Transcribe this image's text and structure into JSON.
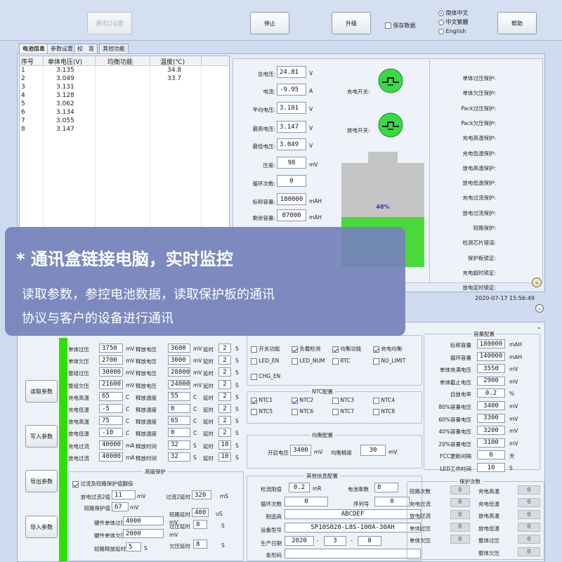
{
  "toolbar": {
    "comm_settings": "通讯口设置",
    "stop": "停止",
    "upgrade": "升级",
    "save_data": "保存数据",
    "help": "帮助",
    "languages": [
      "简体中文",
      "中文繁體",
      "English"
    ],
    "selected_language": "简体中文"
  },
  "tabs": [
    "电池信息",
    "参数设置",
    "校　准",
    "其他功能"
  ],
  "cell_table": {
    "headers": [
      "序号",
      "单体电压(V)",
      "均衡功能",
      "温度(℃)"
    ],
    "rows": [
      [
        "1",
        "3.135",
        "",
        "34.8"
      ],
      [
        "2",
        "3.049",
        "",
        "33.7"
      ],
      [
        "3",
        "3.131",
        "",
        ""
      ],
      [
        "4",
        "3.128",
        "",
        ""
      ],
      [
        "5",
        "3.062",
        "",
        ""
      ],
      [
        "6",
        "3.134",
        "",
        ""
      ],
      [
        "7",
        "3.055",
        "",
        ""
      ],
      [
        "8",
        "3.147",
        "",
        ""
      ]
    ]
  },
  "battery": {
    "total_voltage_label": "总电压:",
    "total_voltage": "24.81",
    "total_voltage_unit": "V",
    "current_label": "电流:",
    "current": "-9.95",
    "current_unit": "A",
    "avg_voltage_label": "平均电压:",
    "avg_voltage": "3.101",
    "avg_voltage_unit": "V",
    "max_voltage_label": "最高电压:",
    "max_voltage": "3.147",
    "max_voltage_unit": "V",
    "min_voltage_label": "最低电压:",
    "min_voltage": "3.049",
    "min_voltage_unit": "V",
    "diff_label": "压差:",
    "diff": "98",
    "diff_unit": "mV",
    "cycles_label": "循环次数:",
    "cycles": "0",
    "nominal_label": "标称容量:",
    "nominal": "180000",
    "nominal_unit": "mAH",
    "remaining_label": "剩余容量:",
    "remaining": "87000",
    "remaining_unit": "mAH",
    "charge_switch": "充电开关:",
    "discharge_switch": "放电开关:",
    "soc_text": "48%",
    "soc": 0.48,
    "soc_color": "#4bd83a"
  },
  "protections": [
    "单体过压保护:",
    "单体欠压保护:",
    "Pack过压保护:",
    "Pack欠压保护:",
    "充电高温保护:",
    "充电低温保护:",
    "放电高温保护:",
    "放电低温保护:",
    "充电过流保护:",
    "放电过流保护:",
    "短路保护:",
    "检测芯片错误:",
    "保护板锁定:",
    "充电超时锁定:",
    "放电定时锁定:"
  ],
  "timestamp": "2020-07-17 15:56:49",
  "overlay": {
    "title": "* 通讯盒链接电脑，实时监控",
    "line1": "读取参数，参控电池数据，读取保护板的通讯",
    "line2": "协议与客户的设备进行通讯"
  },
  "side_buttons": [
    "读取参数",
    "写入参数",
    "导出参数",
    "导入参数"
  ],
  "params": [
    {
      "l1": "单体过压",
      "v1": "3750",
      "u1": "mV",
      "l2": "释放电压",
      "v2": "3600",
      "u2": "mV",
      "l3": "延时",
      "v3": "2",
      "u3": "S"
    },
    {
      "l1": "单体欠压",
      "v1": "2700",
      "u1": "mV",
      "l2": "释放电压",
      "v2": "3000",
      "u2": "mV",
      "l3": "延时",
      "v3": "2",
      "u3": "S"
    },
    {
      "l1": "整组过压",
      "v1": "30000",
      "u1": "mV",
      "l2": "释放电压",
      "v2": "28800",
      "u2": "mV",
      "l3": "延时",
      "v3": "2",
      "u3": "S"
    },
    {
      "l1": "整组欠压",
      "v1": "21600",
      "u1": "mV",
      "l2": "释放电压",
      "v2": "24000",
      "u2": "mV",
      "l3": "延时",
      "v3": "2",
      "u3": "S"
    },
    {
      "l1": "充电高温",
      "v1": "65",
      "u1": "C",
      "l2": "释放温度",
      "v2": "55",
      "u2": "C",
      "l3": "延时",
      "v3": "2",
      "u3": "S"
    },
    {
      "l1": "充电低温",
      "v1": "-5",
      "u1": "C",
      "l2": "释放温度",
      "v2": "0",
      "u2": "C",
      "l3": "延时",
      "v3": "2",
      "u3": "S"
    },
    {
      "l1": "放电高温",
      "v1": "75",
      "u1": "C",
      "l2": "释放温度",
      "v2": "65",
      "u2": "C",
      "l3": "延时",
      "v3": "2",
      "u3": "S"
    },
    {
      "l1": "放电低温",
      "v1": "-10",
      "u1": "C",
      "l2": "释放温度",
      "v2": "0",
      "u2": "C",
      "l3": "延时",
      "v3": "2",
      "u3": "S"
    },
    {
      "l1": "充电过流",
      "v1": "40000",
      "u1": "mA",
      "l2": "释放时间",
      "v2": "32",
      "u2": "S",
      "l3": "延时",
      "v3": "10",
      "u3": "S"
    },
    {
      "l1": "放电过流",
      "v1": "40000",
      "u1": "mA",
      "l2": "释放时间",
      "v2": "32",
      "u2": "S",
      "l3": "延时",
      "v3": "10",
      "u3": "S"
    }
  ],
  "advanced": {
    "title": "高级保护",
    "checkbox": "过流及短路保护值翻倍",
    "oc2_label": "放电过流2值",
    "oc2": "11",
    "oc2_unit": "mV",
    "sc_label": "短路保护值",
    "sc": "67",
    "sc_unit": "mV",
    "oc2_delay_label": "过流2延时",
    "oc2_delay": "320",
    "oc2_delay_unit": "mS",
    "sc_delay_label": "短路延时",
    "sc_delay": "400",
    "sc_delay_unit": "uS",
    "hw_ov_label": "硬件单体过压",
    "hw_ov": "4000",
    "hw_ov_unit": "mV",
    "hw_uv_label": "硬件单体欠压",
    "hw_uv": "2000",
    "hw_uv_unit": "mV",
    "ov_delay_label": "过压延时",
    "ov_delay": "8",
    "ov_delay_unit": "S",
    "uv_delay_label": "欠压延时",
    "uv_delay": "8",
    "uv_delay_unit": "S",
    "sc_release_label": "短路释放延时",
    "sc_release": "5",
    "sc_release_unit": "S"
  },
  "switches": [
    {
      "label": "开关功能",
      "on": false
    },
    {
      "label": "负载检测",
      "on": true
    },
    {
      "label": "均衡功能",
      "on": true
    },
    {
      "label": "充电均衡",
      "on": true
    },
    {
      "label": "LED_EN",
      "on": false
    },
    {
      "label": "LED_NUM",
      "on": false
    },
    {
      "label": "RTC",
      "on": false
    },
    {
      "label": "NO_LIMIT",
      "on": false
    },
    {
      "label": "CHG_EN",
      "on": false
    }
  ],
  "ntc": {
    "title": "NTC配置",
    "items": [
      {
        "label": "NTC1",
        "on": true
      },
      {
        "label": "NTC2",
        "on": true
      },
      {
        "label": "NTC3",
        "on": false
      },
      {
        "label": "NTC4",
        "on": false
      },
      {
        "label": "NTC5",
        "on": false
      },
      {
        "label": "NTC6",
        "on": false
      },
      {
        "label": "NTC7",
        "on": false
      },
      {
        "label": "NTC8",
        "on": false
      }
    ]
  },
  "balance": {
    "title": "均衡配置",
    "start_label": "开启电压",
    "start": "3400",
    "start_unit": "mV",
    "precision_label": "均衡精度",
    "precision": "30",
    "precision_unit": "mV"
  },
  "other_info": {
    "title": "其他信息配置",
    "detect_label": "检流阻值",
    "detect": "0.2",
    "detect_unit": "mR",
    "cells_label": "电池串数",
    "cells": "8",
    "cycles_label": "循环次数",
    "cycles": "0",
    "serial_label": "序列号",
    "serial": "0",
    "maker_label": "制造商",
    "maker": "ABCDEF",
    "model_label": "设备型号",
    "model": "SP10S020-L8S-100A-30AH",
    "date_label": "生产日期",
    "year": "2020",
    "month": "3",
    "day": "8",
    "barcode_label": "条形码",
    "barcode": ""
  },
  "capacity": {
    "title": "容量配置",
    "rows": [
      {
        "label": "标称容量",
        "value": "180000",
        "unit": "mAH"
      },
      {
        "label": "循环容量",
        "value": "140000",
        "unit": "mAH"
      },
      {
        "label": "单体充满电压",
        "value": "3550",
        "unit": "mV"
      },
      {
        "label": "单体截止电压",
        "value": "2900",
        "unit": "mV"
      },
      {
        "label": "自放电率",
        "value": "0.2",
        "unit": "%"
      },
      {
        "label": "80%容量电压",
        "value": "3400",
        "unit": "mV"
      },
      {
        "label": "60%容量电压",
        "value": "3300",
        "unit": "mV"
      },
      {
        "label": "40%容量电压",
        "value": "3200",
        "unit": "mV"
      },
      {
        "label": "20%容量电压",
        "value": "3100",
        "unit": "mV"
      },
      {
        "label": "FCC更新间隔",
        "value": "0",
        "unit": "天"
      },
      {
        "label": "LED工作时间",
        "value": "10",
        "unit": "S"
      }
    ]
  },
  "prot_counts": {
    "title": "保护次数",
    "rows": [
      {
        "l1": "短路次数",
        "v1": "0",
        "l2": "充电高温",
        "v2": "0"
      },
      {
        "l1": "充电过流",
        "v1": "0",
        "l2": "充电低温",
        "v2": "0"
      },
      {
        "l1": "放电过流",
        "v1": "0",
        "l2": "放电高温",
        "v2": "0"
      },
      {
        "l1": "单体过压",
        "v1": "0",
        "l2": "放电低温",
        "v2": "0"
      },
      {
        "l1": "单体欠压",
        "v1": "0",
        "l2": "整体过压",
        "v2": "0"
      },
      {
        "l1": "",
        "v1": "",
        "l2": "整体欠压",
        "v2": "0"
      }
    ]
  }
}
